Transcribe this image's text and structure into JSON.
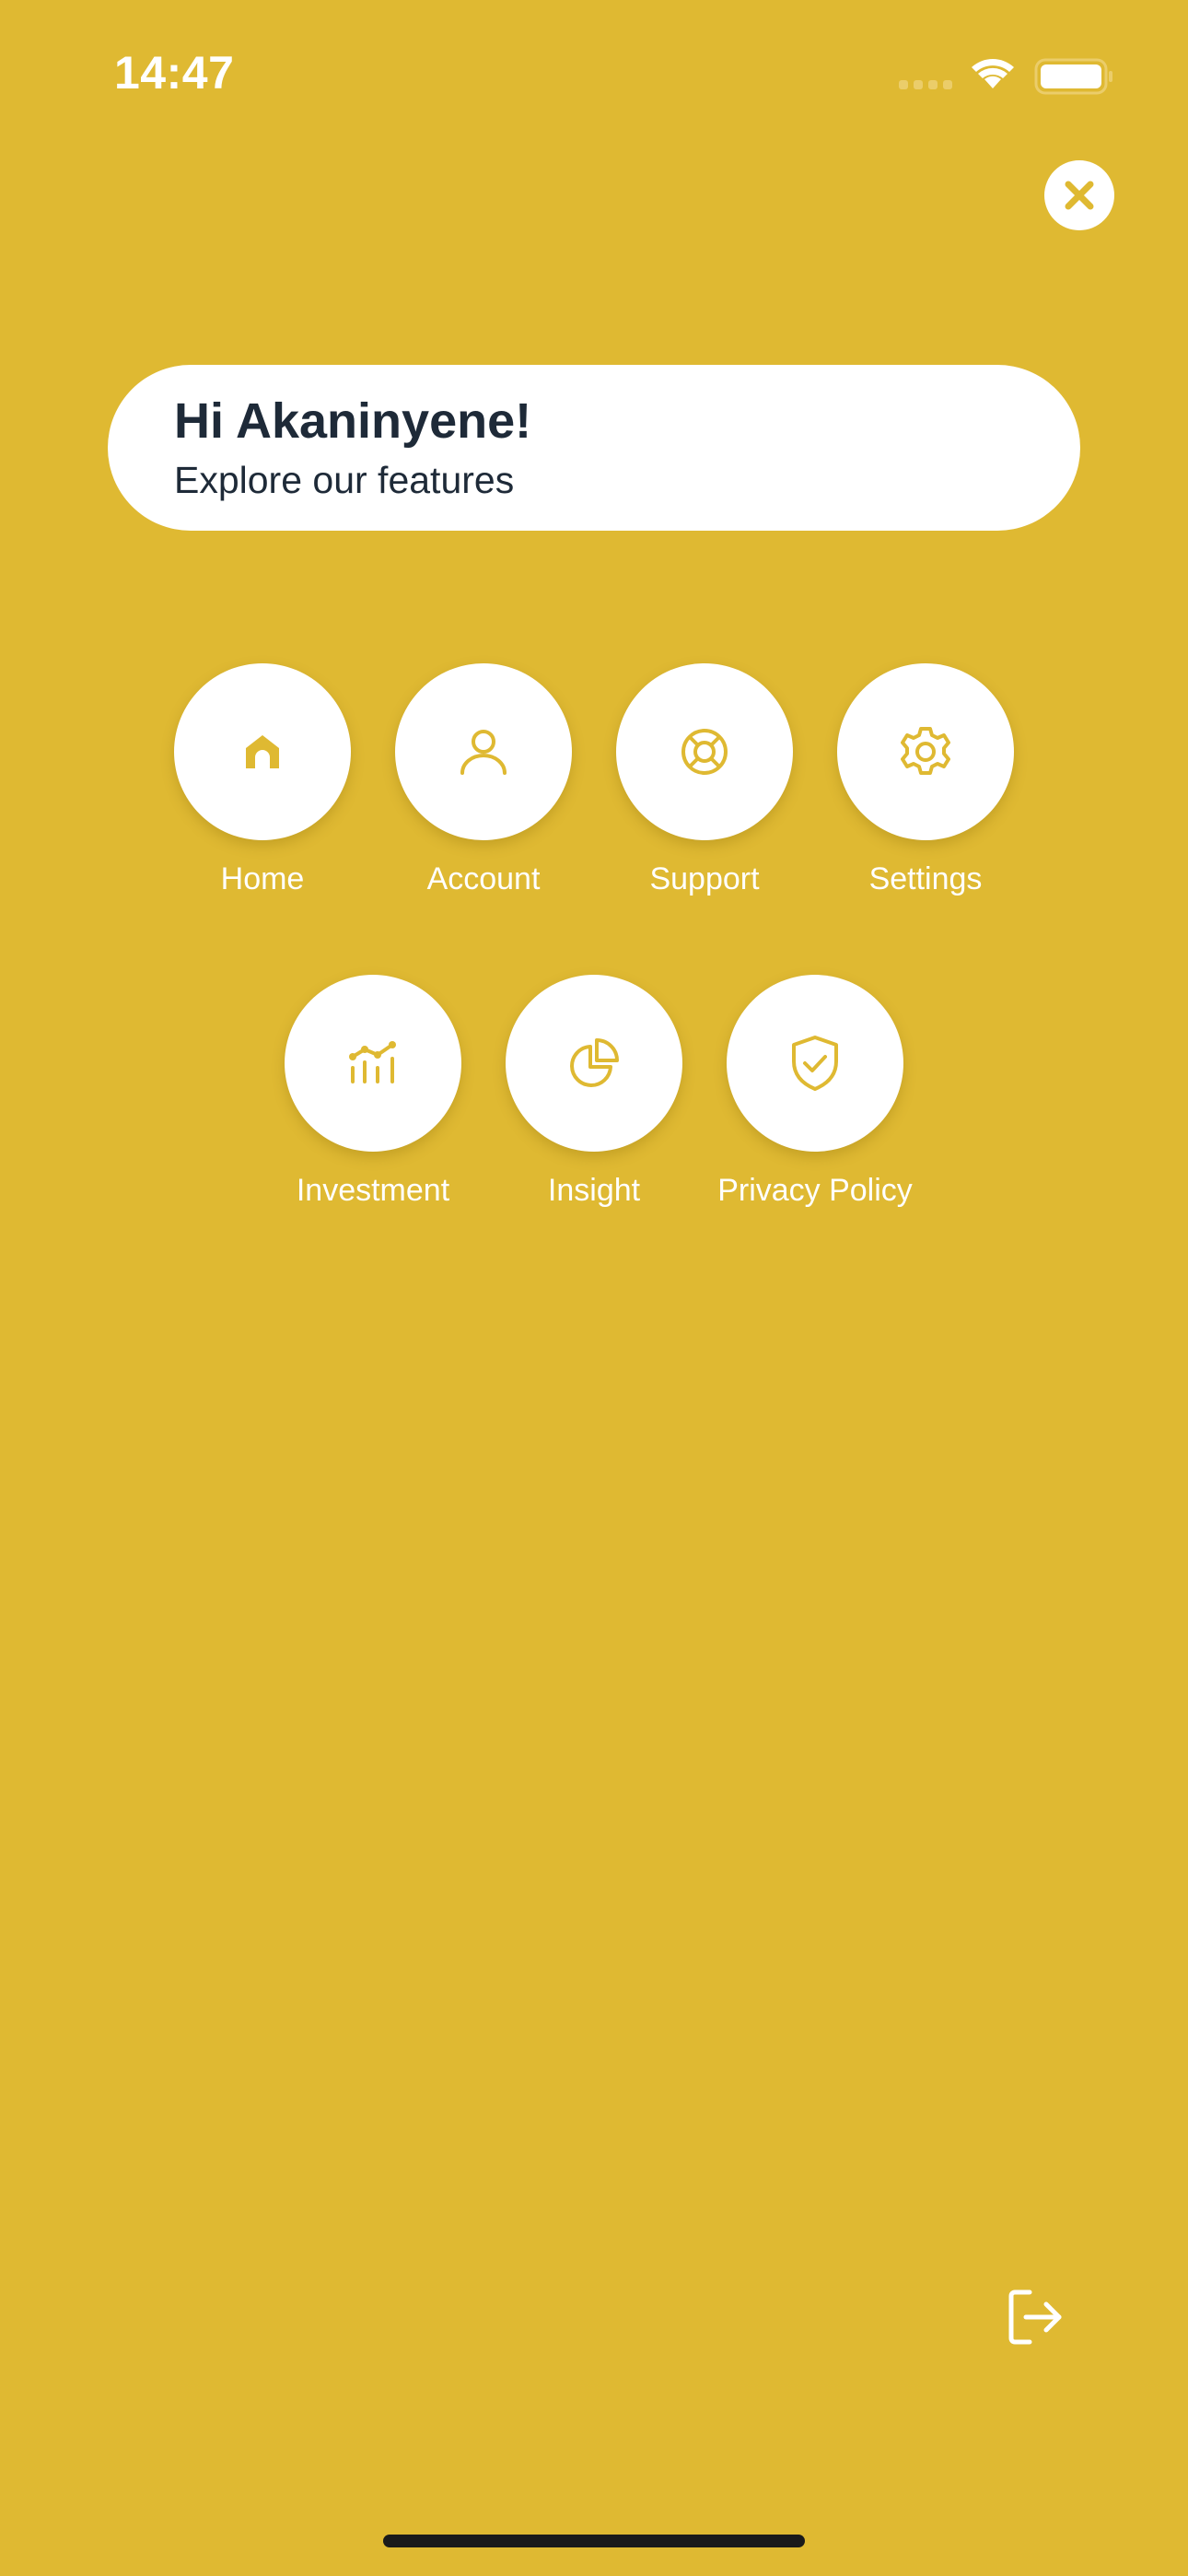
{
  "status_bar": {
    "time": "14:47"
  },
  "greeting": {
    "title": "Hi Akaninyene!",
    "subtitle": "Explore our features"
  },
  "menu": {
    "items": [
      {
        "label": "Home",
        "icon": "home-icon"
      },
      {
        "label": "Account",
        "icon": "person-icon"
      },
      {
        "label": "Support",
        "icon": "lifebuoy-icon"
      },
      {
        "label": "Settings",
        "icon": "gear-icon"
      },
      {
        "label": "Investment",
        "icon": "chart-icon"
      },
      {
        "label": "Insight",
        "icon": "pie-chart-icon"
      },
      {
        "label": "Privacy Policy",
        "icon": "shield-check-icon"
      }
    ]
  },
  "colors": {
    "background": "#DFB932",
    "accent": "#DFB932",
    "card": "#FFFFFF",
    "text_dark": "#1E2A38"
  }
}
